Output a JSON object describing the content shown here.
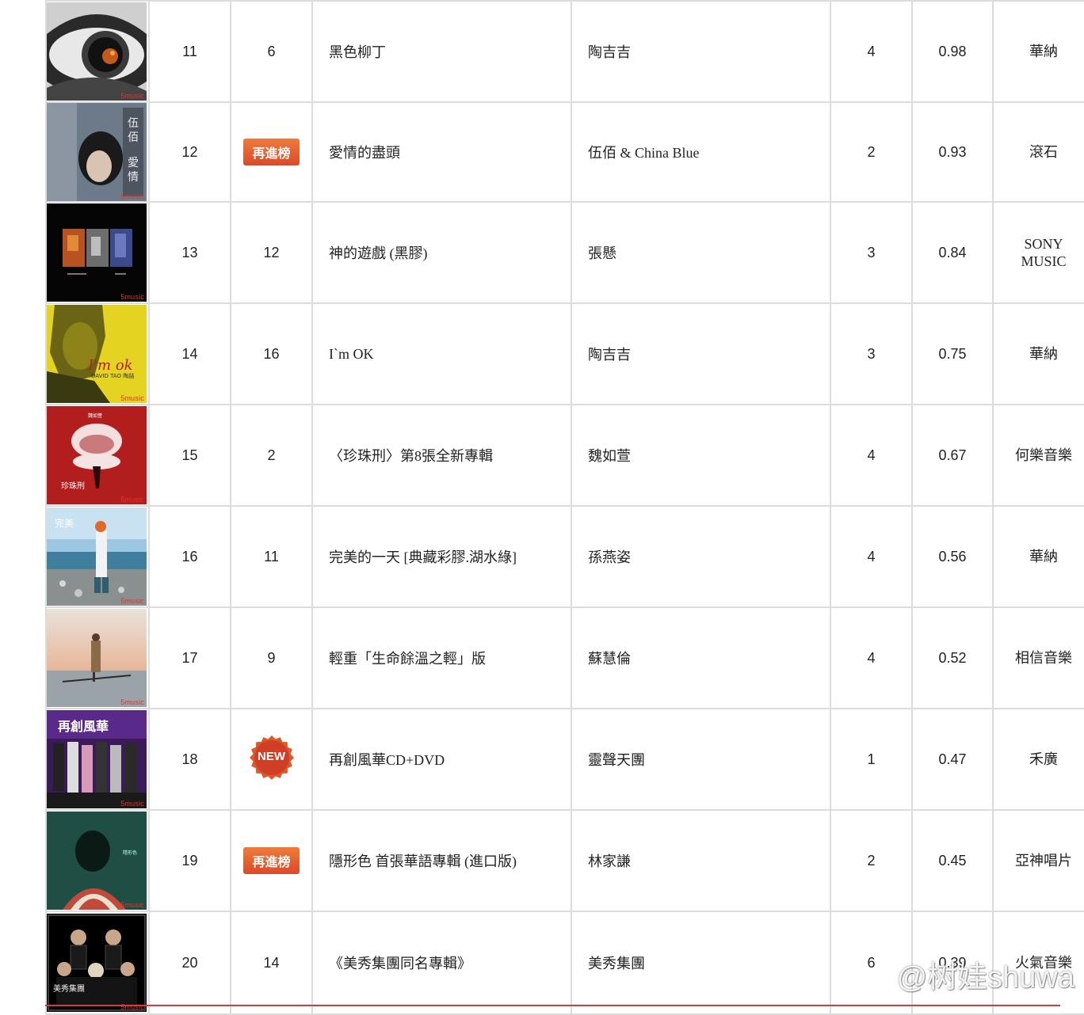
{
  "rows": [
    {
      "rank": "11",
      "last": "6",
      "badge": "",
      "title": "黑色柳丁",
      "artist": "陶吉吉",
      "weeks": "4",
      "share": "0.98",
      "label": "華納",
      "cover": "eye-cover"
    },
    {
      "rank": "12",
      "last": "",
      "badge": "再進榜",
      "title": "愛情的盡頭",
      "artist": "伍佰 & China Blue",
      "weeks": "2",
      "share": "0.93",
      "label": "滾石",
      "cover": "portrait-cover"
    },
    {
      "rank": "13",
      "last": "12",
      "badge": "",
      "title": "神的遊戲 (黑膠)",
      "artist": "張懸",
      "weeks": "3",
      "share": "0.84",
      "label": "SONY MUSIC",
      "cover": "triptych-cover"
    },
    {
      "rank": "14",
      "last": "16",
      "badge": "",
      "title": "I`m OK",
      "artist": "陶吉吉",
      "weeks": "3",
      "share": "0.75",
      "label": "華納",
      "cover": "yellow-cover"
    },
    {
      "rank": "15",
      "last": "2",
      "badge": "",
      "title": "〈珍珠刑〉第8張全新專輯",
      "artist": "魏如萱",
      "weeks": "4",
      "share": "0.67",
      "label": "何樂音樂",
      "cover": "pearl-cover"
    },
    {
      "rank": "16",
      "last": "11",
      "badge": "",
      "title": "完美的一天 [典藏彩膠.湖水綠]",
      "artist": "孫燕姿",
      "weeks": "4",
      "share": "0.56",
      "label": "華納",
      "cover": "beach-cover"
    },
    {
      "rank": "17",
      "last": "9",
      "badge": "",
      "title": "輕重「生命餘溫之輕」版",
      "artist": "蘇慧倫",
      "weeks": "4",
      "share": "0.52",
      "label": "相信音樂",
      "cover": "sunset-cover"
    },
    {
      "rank": "18",
      "last": "",
      "badge": "NEW",
      "title": "再創風華CD+DVD",
      "artist": "靈聲天團",
      "weeks": "1",
      "share": "0.47",
      "label": "禾廣",
      "cover": "group-cover"
    },
    {
      "rank": "19",
      "last": "",
      "badge": "再進榜",
      "title": "隱形色 首張華語專輯 (進口版)",
      "artist": "林家謙",
      "weeks": "2",
      "share": "0.45",
      "label": "亞神唱片",
      "cover": "green-cover"
    },
    {
      "rank": "20",
      "last": "14",
      "badge": "",
      "title": "《美秀集團同名專輯》",
      "artist": "美秀集團",
      "weeks": "6",
      "share": "0.39",
      "label": "火氣音樂",
      "cover": "band-cover"
    }
  ],
  "cover_mark": "5music",
  "watermark": "@树娃shuwa"
}
